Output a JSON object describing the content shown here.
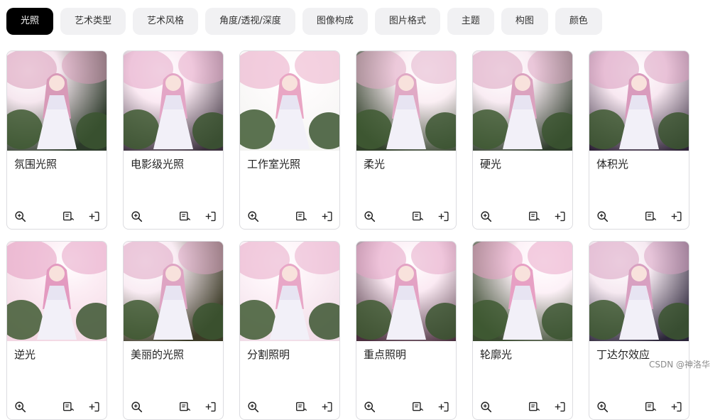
{
  "tabs": [
    {
      "label": "光照",
      "active": true
    },
    {
      "label": "艺术类型",
      "active": false
    },
    {
      "label": "艺术风格",
      "active": false
    },
    {
      "label": "角度/透视/深度",
      "active": false
    },
    {
      "label": "图像构成",
      "active": false
    },
    {
      "label": "图片格式",
      "active": false
    },
    {
      "label": "主题",
      "active": false
    },
    {
      "label": "构图",
      "active": false
    },
    {
      "label": "颜色",
      "active": false
    }
  ],
  "cards": [
    {
      "label": "氛围光照"
    },
    {
      "label": "电影级光照"
    },
    {
      "label": "工作室光照"
    },
    {
      "label": "柔光"
    },
    {
      "label": "硬光"
    },
    {
      "label": "体积光"
    },
    {
      "label": "逆光"
    },
    {
      "label": "美丽的光照"
    },
    {
      "label": "分割照明"
    },
    {
      "label": "重点照明"
    },
    {
      "label": "轮廓光"
    },
    {
      "label": "丁达尔效应"
    }
  ],
  "icons": {
    "zoom": "zoom-in-icon",
    "list": "prompt-list-icon",
    "add": "add-to-prompt-icon"
  },
  "colors": {
    "active_tab_bg": "#000000",
    "tab_bg": "#f1f1f3",
    "card_border": "#dcdce0"
  },
  "watermark": "CSDN @神洛华"
}
